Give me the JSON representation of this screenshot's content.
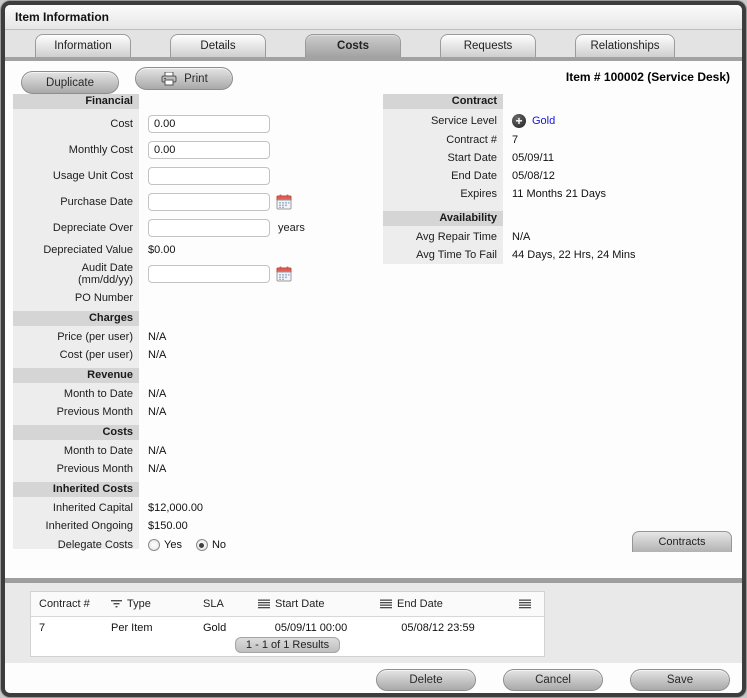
{
  "window": {
    "title": "Item Information",
    "item_ref": "Item # 100002 (Service Desk)"
  },
  "tabs": {
    "information": "Information",
    "details": "Details",
    "costs": "Costs",
    "requests": "Requests",
    "relationships": "Relationships",
    "active_tab": "Costs"
  },
  "toolbar": {
    "duplicate_label": "Duplicate",
    "print_label": "Print"
  },
  "financial": {
    "title": "Financial",
    "cost_label": "Cost",
    "cost_value": "0.00",
    "monthly_cost_label": "Monthly Cost",
    "monthly_cost_value": "0.00",
    "usage_unit_cost_label": "Usage Unit Cost",
    "usage_unit_cost_value": "",
    "purchase_date_label": "Purchase Date",
    "purchase_date_value": "",
    "depreciate_over_label": "Depreciate Over",
    "depreciate_over_value": "",
    "depreciate_over_suffix": "years",
    "depreciated_value_label": "Depreciated Value",
    "depreciated_value": "$0.00",
    "audit_date_label": "Audit Date",
    "audit_date_format": "(mm/dd/yy)",
    "audit_date_value": "",
    "po_number_label": "PO Number",
    "po_number_value": ""
  },
  "charges": {
    "title": "Charges",
    "price_per_user_label": "Price (per user)",
    "price_per_user": "N/A",
    "cost_per_user_label": "Cost (per user)",
    "cost_per_user": "N/A"
  },
  "revenue": {
    "title": "Revenue",
    "month_to_date_label": "Month to Date",
    "month_to_date": "N/A",
    "previous_month_label": "Previous Month",
    "previous_month": "N/A"
  },
  "costs": {
    "title": "Costs",
    "month_to_date_label": "Month to Date",
    "month_to_date": "N/A",
    "previous_month_label": "Previous Month",
    "previous_month": "N/A"
  },
  "inherited": {
    "title": "Inherited Costs",
    "capital_label": "Inherited Capital",
    "capital": "$12,000.00",
    "ongoing_label": "Inherited Ongoing",
    "ongoing": "$150.00",
    "delegate_label": "Delegate Costs",
    "yes_label": "Yes",
    "no_label": "No",
    "delegate_selected": "No"
  },
  "contract": {
    "title": "Contract",
    "service_level_label": "Service Level",
    "service_level": "Gold",
    "contract_no_label": "Contract #",
    "contract_no": "7",
    "start_date_label": "Start Date",
    "start_date": "05/09/11",
    "end_date_label": "End Date",
    "end_date": "05/08/12",
    "expires_label": "Expires",
    "expires": "11 Months 21 Days"
  },
  "availability": {
    "title": "Availability",
    "avg_repair_time_label": "Avg Repair Time",
    "avg_repair_time": "N/A",
    "avg_time_to_fail_label": "Avg Time To Fail",
    "avg_time_to_fail": "44 Days, 22 Hrs, 24 Mins"
  },
  "contracts_panel": {
    "tab_label": "Contracts",
    "headers": {
      "contract_no": "Contract #",
      "type": "Type",
      "sla": "SLA",
      "start_date": "Start Date",
      "end_date": "End Date"
    },
    "row": {
      "contract_no": "7",
      "type": "Per Item",
      "sla": "Gold",
      "start_date": "05/09/11 00:00",
      "end_date": "05/08/12 23:59"
    },
    "pagination": "1 - 1 of 1 Results"
  },
  "footer": {
    "delete_label": "Delete",
    "cancel_label": "Cancel",
    "save_label": "Save"
  },
  "icons": {
    "print": "printer-icon",
    "purchase_date": "calendar-icon",
    "audit_date": "calendar-icon",
    "service_level": "plus-circle-icon",
    "type_column": "filter-icon",
    "date_columns": "menu-icon"
  },
  "colors": {
    "link_blue": "#1515d6",
    "calendar_red": "#e06055",
    "active_tab_gray": "#a2a2a2",
    "section_header_gray": "#d5d5d5",
    "frame_dark": "#3d3d3d"
  }
}
